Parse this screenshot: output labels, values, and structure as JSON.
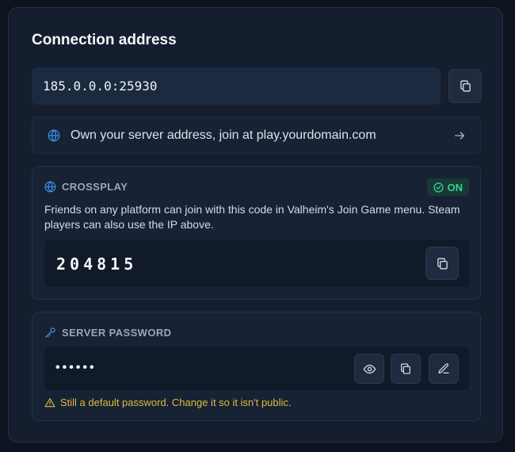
{
  "title": "Connection address",
  "address": {
    "value": "185.0.0.0:25930"
  },
  "custom_domain": {
    "text": "Own your server address, join at play.yourdomain.com"
  },
  "crossplay": {
    "heading": "CROSSPLAY",
    "status": "ON",
    "description": "Friends on any platform can join with this code in Valheim's Join Game menu. Steam players can also use the IP above.",
    "code": "204815"
  },
  "server_password": {
    "heading": "SERVER PASSWORD",
    "masked_value": "••••••",
    "warning": "Still a default password. Change it so it isn't public."
  },
  "colors": {
    "accent_blue": "#3d8ee6",
    "status_green": "#3ccf92",
    "warning_yellow": "#e2b93b"
  },
  "icons": [
    "copy-icon",
    "globe-icon",
    "arrow-right-icon",
    "check-circle-icon",
    "key-icon",
    "eye-icon",
    "edit-icon",
    "warning-icon"
  ]
}
